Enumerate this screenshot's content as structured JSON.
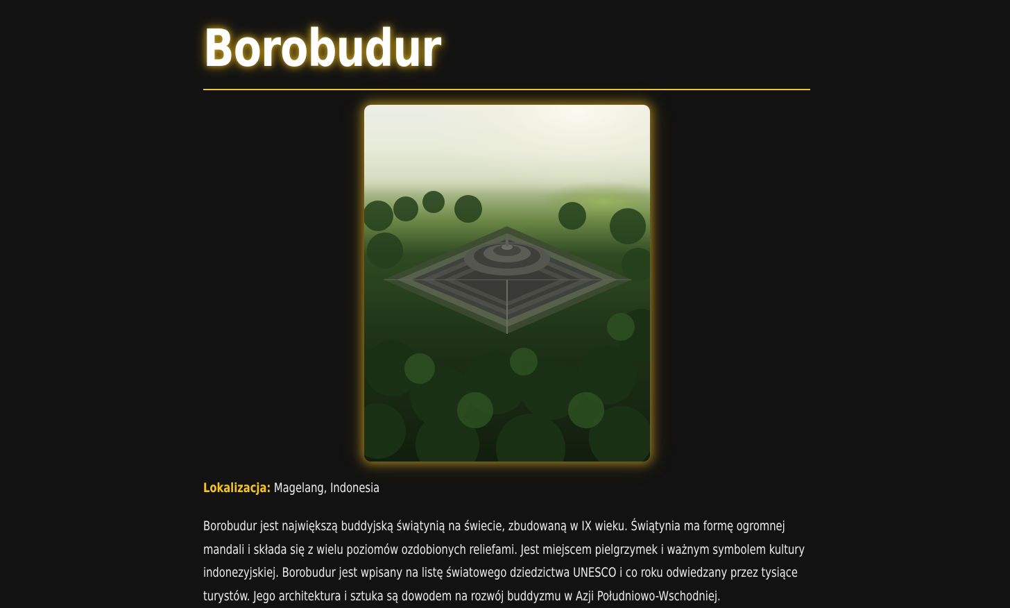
{
  "page": {
    "title": "Borobudur",
    "accent_color": "#f5c518",
    "background_color": "#121212"
  },
  "image": {
    "icon": "aerial-temple-photo",
    "alt": "Borobudur"
  },
  "location": {
    "label": "Lokalizacja:",
    "value": "Magelang, Indonesia"
  },
  "description": {
    "text": "Borobudur jest największą buddyjską świątynią na świecie, zbudowaną w IX wieku. Świątynia ma formę ogromnej mandali i składa się z wielu poziomów ozdobionych reliefami. Jest miejscem pielgrzymek i ważnym symbolem kultury indonezyjskiej. Borobudur jest wpisany na listę światowego dziedzictwa UNESCO i co roku odwiedzany przez tysiące turystów. Jego architektura i sztuka są dowodem na rozwój buddyzmu w Azji Południowo-Wschodniej."
  }
}
